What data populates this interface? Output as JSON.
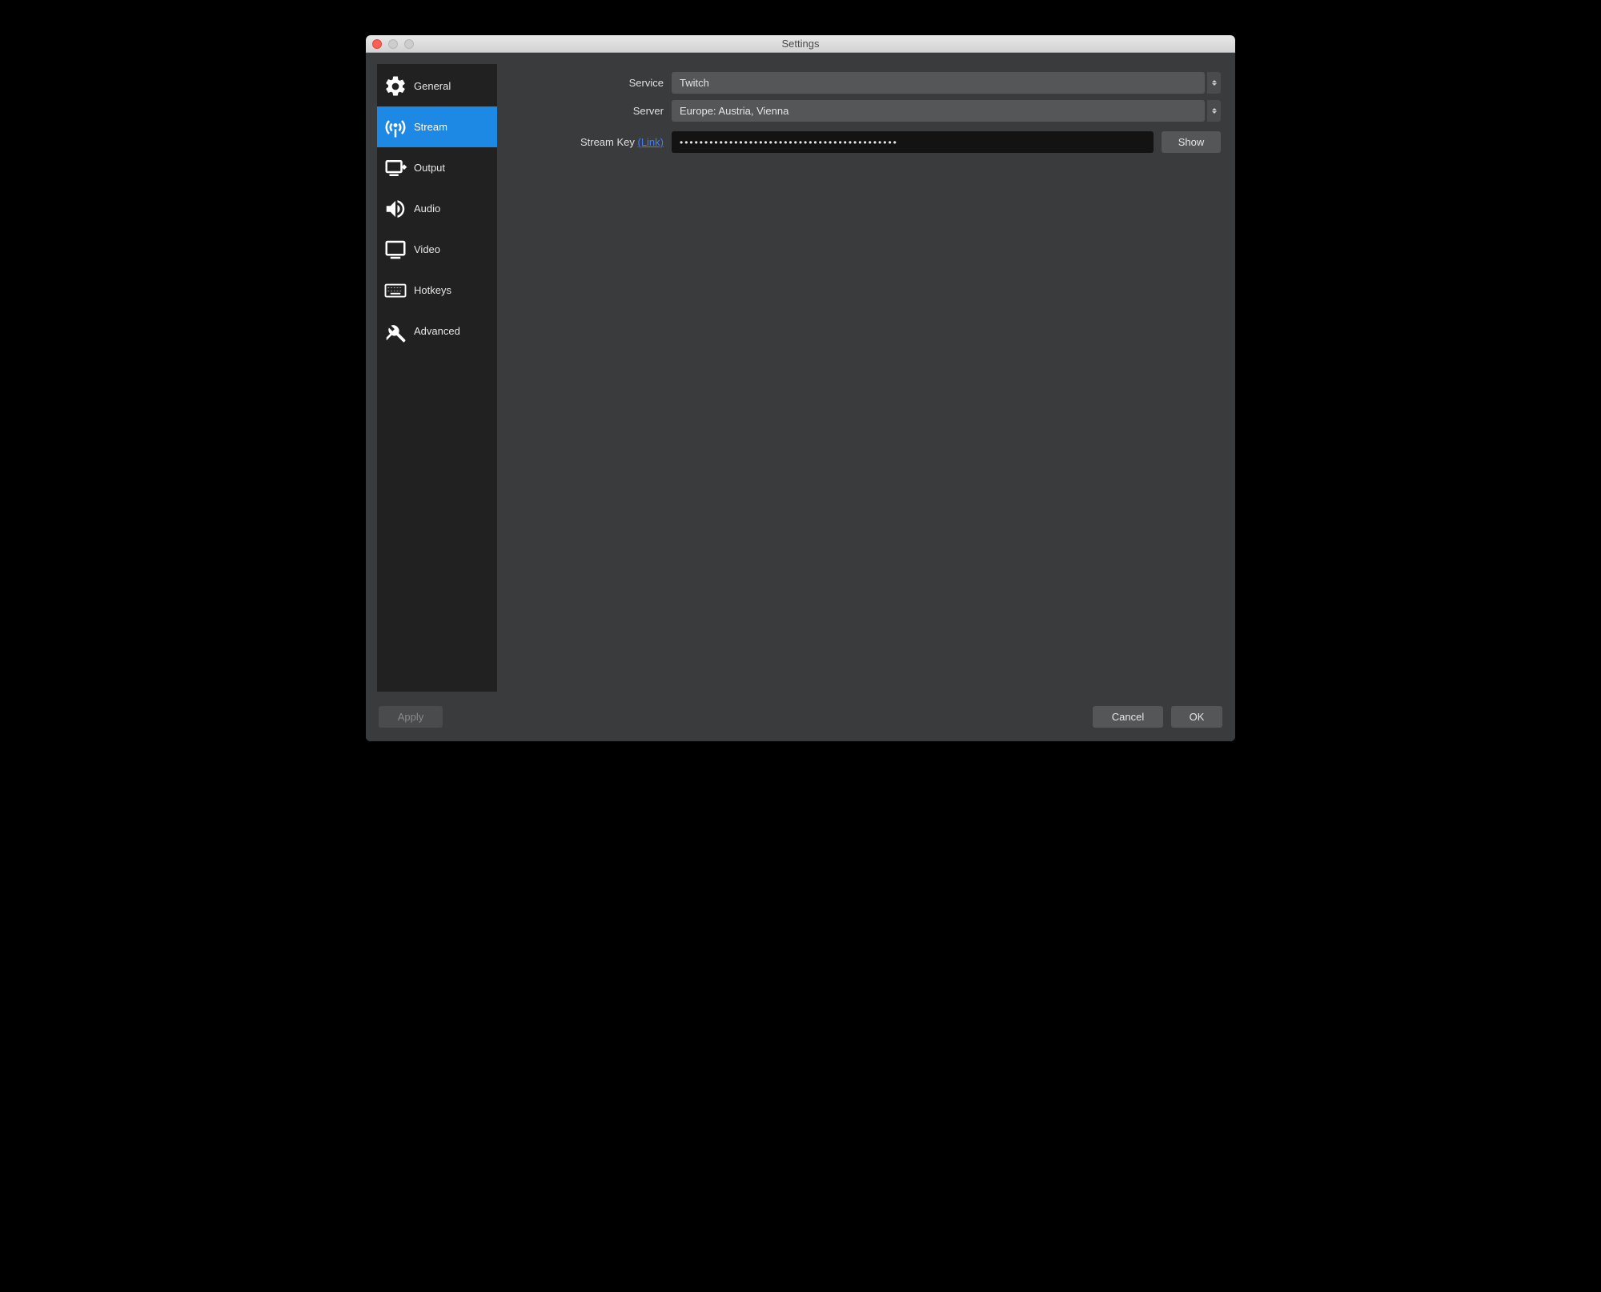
{
  "window": {
    "title": "Settings"
  },
  "sidebar": {
    "items": [
      {
        "label": "General"
      },
      {
        "label": "Stream"
      },
      {
        "label": "Output"
      },
      {
        "label": "Audio"
      },
      {
        "label": "Video"
      },
      {
        "label": "Hotkeys"
      },
      {
        "label": "Advanced"
      }
    ]
  },
  "form": {
    "service_label": "Service",
    "service_value": "Twitch",
    "server_label": "Server",
    "server_value": "Europe: Austria, Vienna",
    "streamkey_label": "Stream Key ",
    "streamkey_link": "(Link)",
    "streamkey_value": "••••••••••••••••••••••••••••••••••••••••••••",
    "show_label": "Show"
  },
  "footer": {
    "apply": "Apply",
    "cancel": "Cancel",
    "ok": "OK"
  }
}
